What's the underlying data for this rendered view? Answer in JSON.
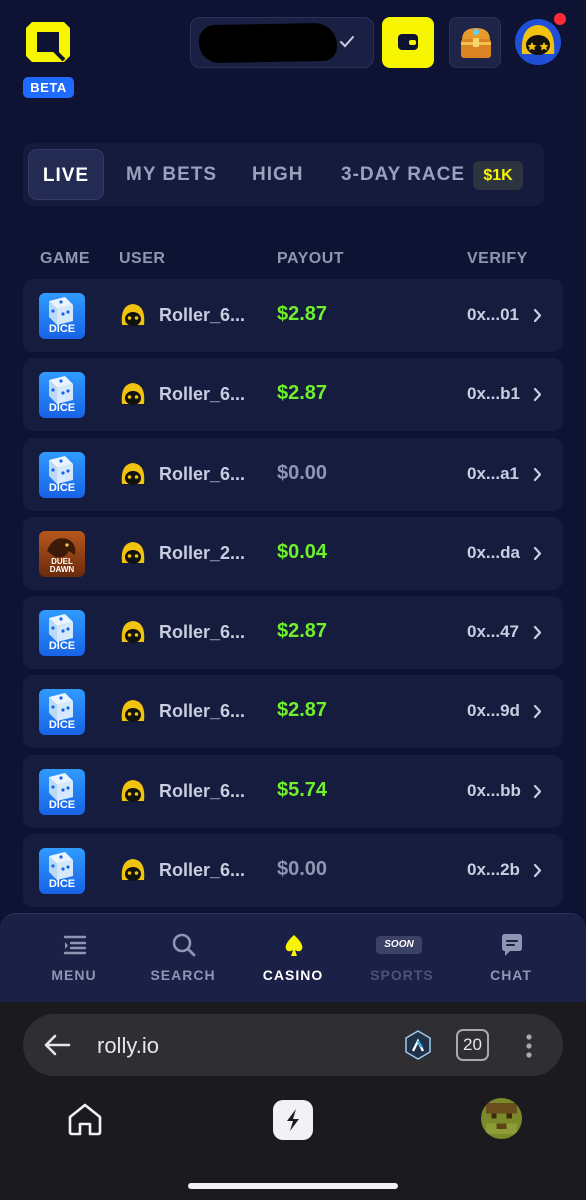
{
  "header": {
    "beta_label": "BETA",
    "balance_hidden": true
  },
  "tabs": [
    {
      "label": "LIVE",
      "active": true
    },
    {
      "label": "MY BETS",
      "active": false
    },
    {
      "label": "HIGH",
      "active": false
    },
    {
      "label": "3-DAY RACE",
      "active": false,
      "badge": "$1K"
    }
  ],
  "table": {
    "columns": [
      "GAME",
      "USER",
      "PAYOUT",
      "VERIFY"
    ],
    "rows": [
      {
        "game": "DICE",
        "game_type": "dice",
        "user": "Roller_6...",
        "payout": "$2.87",
        "win": true,
        "verify": "0x...01"
      },
      {
        "game": "DICE",
        "game_type": "dice",
        "user": "Roller_6...",
        "payout": "$2.87",
        "win": true,
        "verify": "0x...b1"
      },
      {
        "game": "DICE",
        "game_type": "dice",
        "user": "Roller_6...",
        "payout": "$0.00",
        "win": false,
        "verify": "0x...a1"
      },
      {
        "game": "DUEL DAWN",
        "game_type": "duel",
        "user": "Roller_2...",
        "payout": "$0.04",
        "win": true,
        "verify": "0x...da"
      },
      {
        "game": "DICE",
        "game_type": "dice",
        "user": "Roller_6...",
        "payout": "$2.87",
        "win": true,
        "verify": "0x...47"
      },
      {
        "game": "DICE",
        "game_type": "dice",
        "user": "Roller_6...",
        "payout": "$2.87",
        "win": true,
        "verify": "0x...9d"
      },
      {
        "game": "DICE",
        "game_type": "dice",
        "user": "Roller_6...",
        "payout": "$5.74",
        "win": true,
        "verify": "0x...bb"
      },
      {
        "game": "DICE",
        "game_type": "dice",
        "user": "Roller_6...",
        "payout": "$0.00",
        "win": false,
        "verify": "0x...2b"
      }
    ]
  },
  "bottom_nav": {
    "menu": "MENU",
    "search": "SEARCH",
    "casino": "CASINO",
    "sports": "SPORTS",
    "sports_badge": "SOON",
    "chat": "CHAT"
  },
  "browser": {
    "url": "rolly.io",
    "tab_count": "20"
  },
  "colors": {
    "background": "#0e1333",
    "accent_yellow": "#f7f500",
    "win_green": "#6ef02b",
    "beta_blue": "#1f6bff"
  }
}
